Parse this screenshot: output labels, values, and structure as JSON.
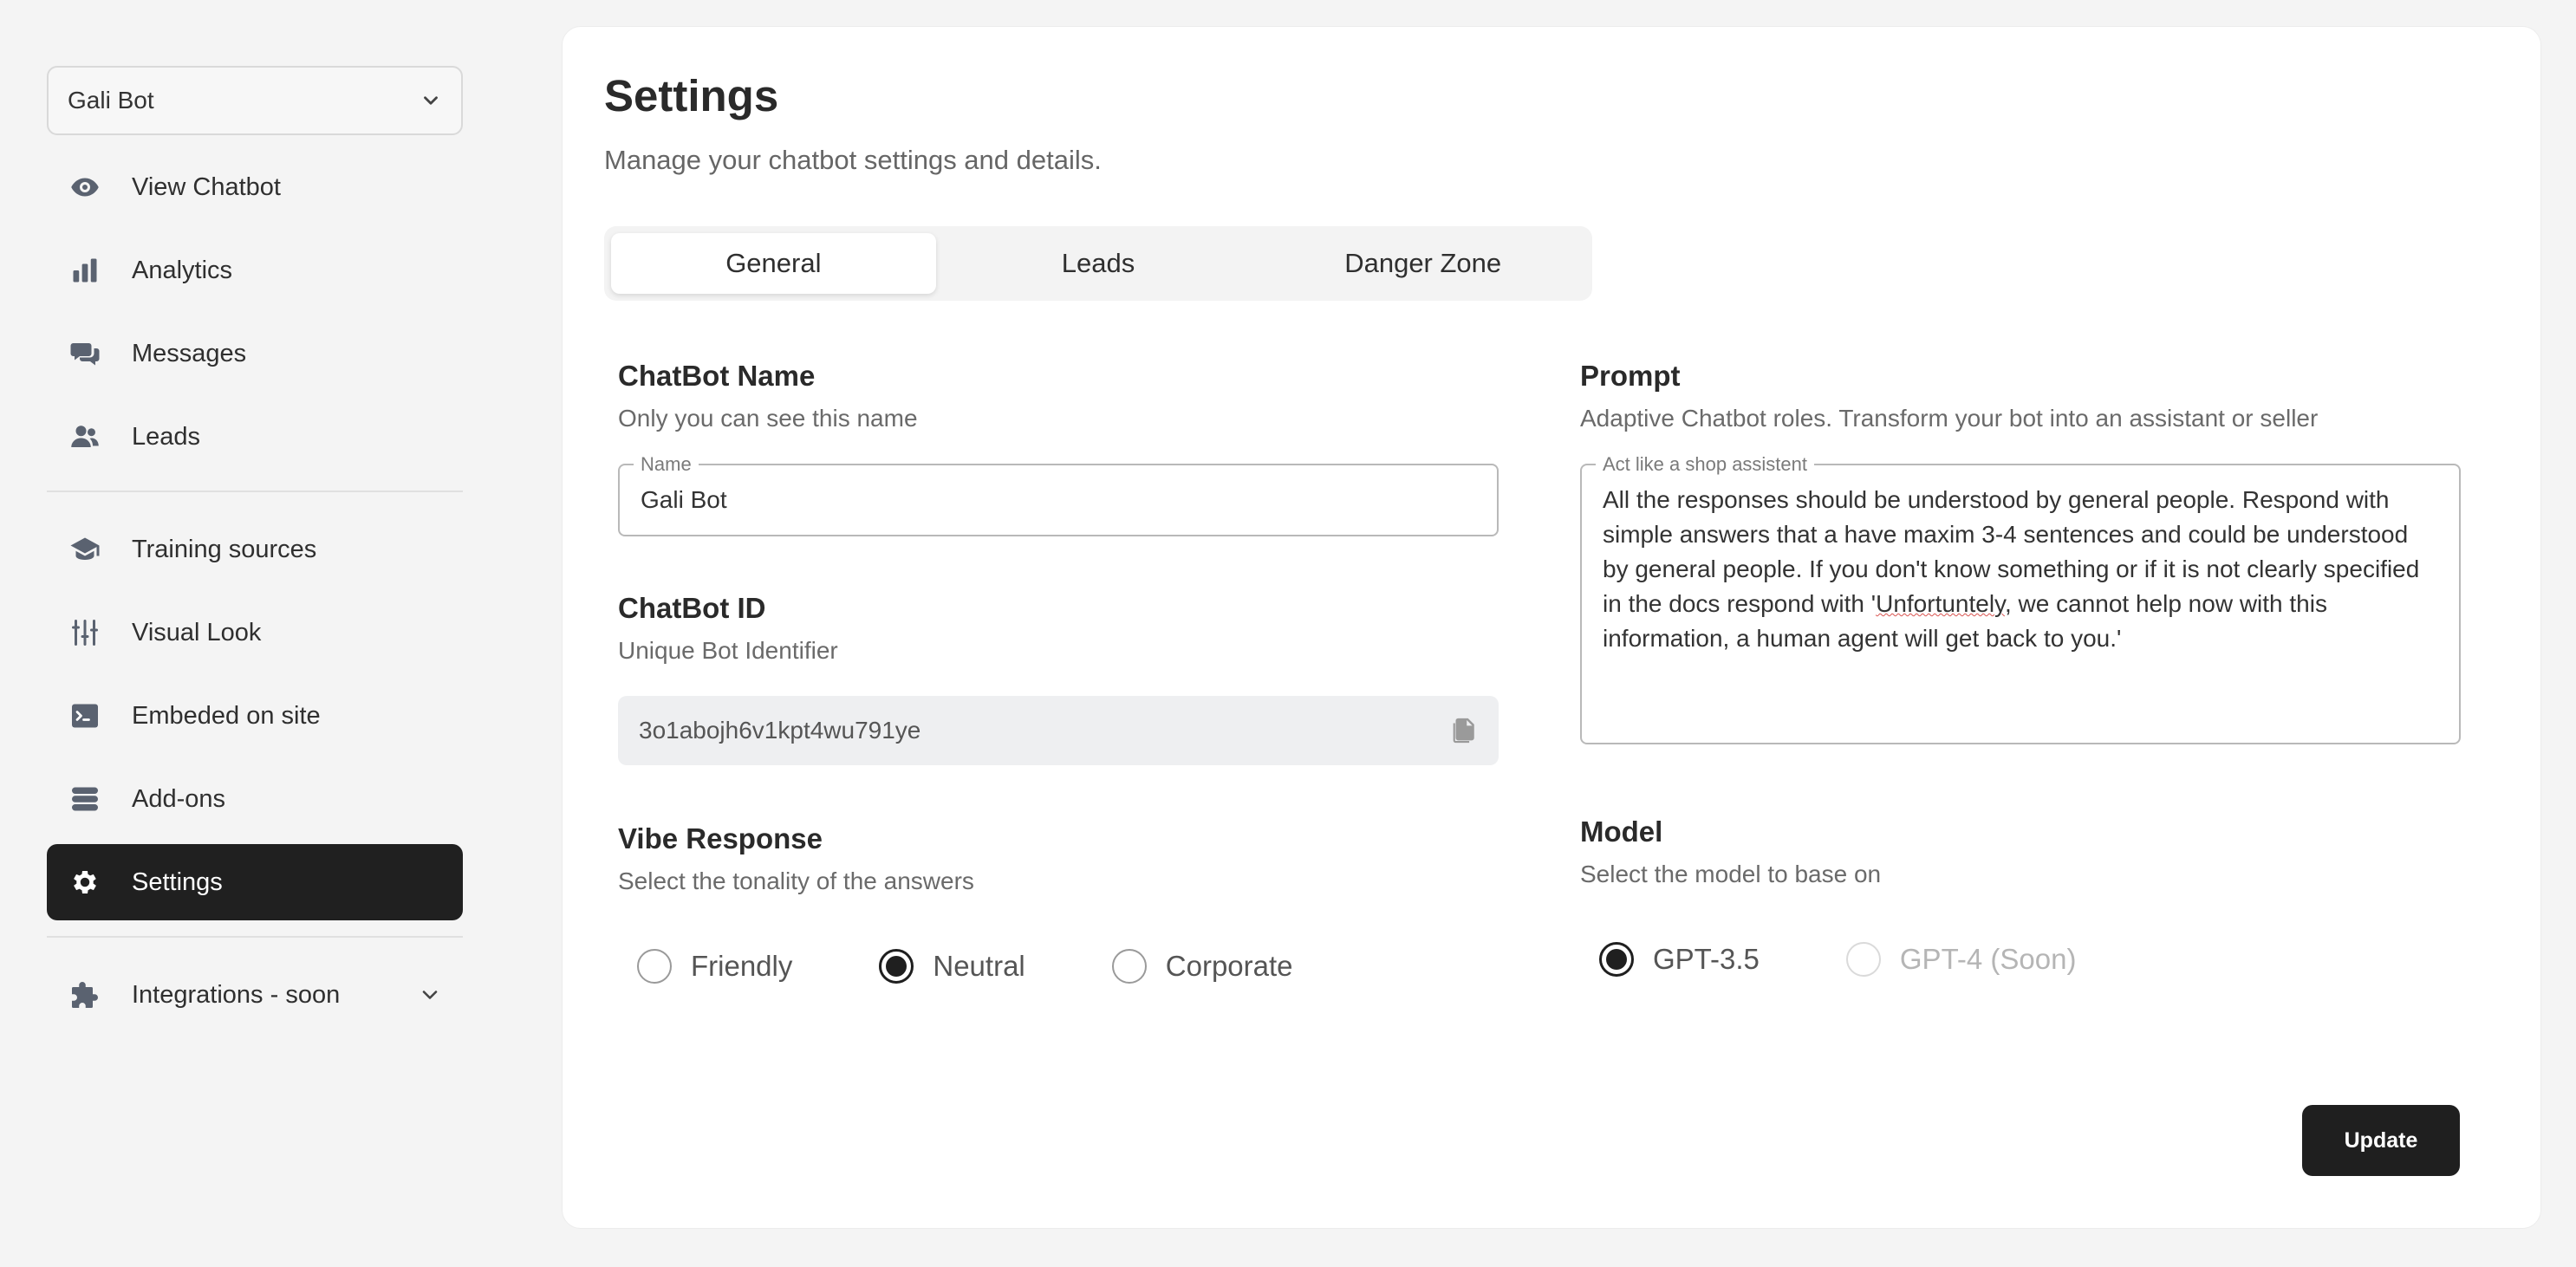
{
  "sidebar": {
    "bot_selector": {
      "value": "Gali Bot"
    },
    "items": [
      {
        "label": "View Chatbot",
        "icon": "eye-icon"
      },
      {
        "label": "Analytics",
        "icon": "bar-chart-icon"
      },
      {
        "label": "Messages",
        "icon": "chat-bubbles-icon"
      },
      {
        "label": "Leads",
        "icon": "users-icon"
      }
    ],
    "items2": [
      {
        "label": "Training sources",
        "icon": "graduation-cap-icon"
      },
      {
        "label": "Visual Look",
        "icon": "sliders-icon"
      },
      {
        "label": "Embeded on site",
        "icon": "terminal-icon"
      },
      {
        "label": "Add-ons",
        "icon": "database-icon"
      },
      {
        "label": "Settings",
        "icon": "gear-icon",
        "active": true
      }
    ],
    "integrations": {
      "label": "Integrations - soon",
      "icon": "puzzle-icon"
    }
  },
  "page": {
    "title": "Settings",
    "subtitle": "Manage your chatbot settings and details.",
    "tabs": [
      {
        "label": "General",
        "active": true
      },
      {
        "label": "Leads"
      },
      {
        "label": "Danger Zone"
      }
    ]
  },
  "chatbot_name": {
    "title": "ChatBot Name",
    "subtitle": "Only you can see this name",
    "field_label": "Name",
    "value": "Gali Bot"
  },
  "chatbot_id": {
    "title": "ChatBot ID",
    "subtitle": "Unique Bot Identifier",
    "value": "3o1abojh6v1kpt4wu791ye"
  },
  "vibe": {
    "title": "Vibe Response",
    "subtitle": "Select the tonality of the answers",
    "options": [
      "Friendly",
      "Neutral",
      "Corporate"
    ],
    "selected": "Neutral"
  },
  "prompt": {
    "title": "Prompt",
    "subtitle": "Adaptive Chatbot roles. Transform your bot into an assistant or seller",
    "field_label": "Act like a shop assistent",
    "text_before": "All the responses should be understood by general people. Respond with simple answers that a have maxim 3-4 sentences and could be understood by general people. If you don't know something or if it is not clearly specified in the docs respond with '",
    "text_misspelled": "Unfortuntely",
    "text_after": ", we cannot help now with this information, a human agent will get back to you.'"
  },
  "model": {
    "title": "Model",
    "subtitle": "Select the model to base on",
    "options": [
      "GPT-3.5",
      "GPT-4 (Soon)"
    ],
    "selected": "GPT-3.5"
  },
  "actions": {
    "update_label": "Update"
  },
  "colors": {
    "accent": "#1f1f1f",
    "background": "#f4f4f4",
    "card": "#ffffff"
  }
}
